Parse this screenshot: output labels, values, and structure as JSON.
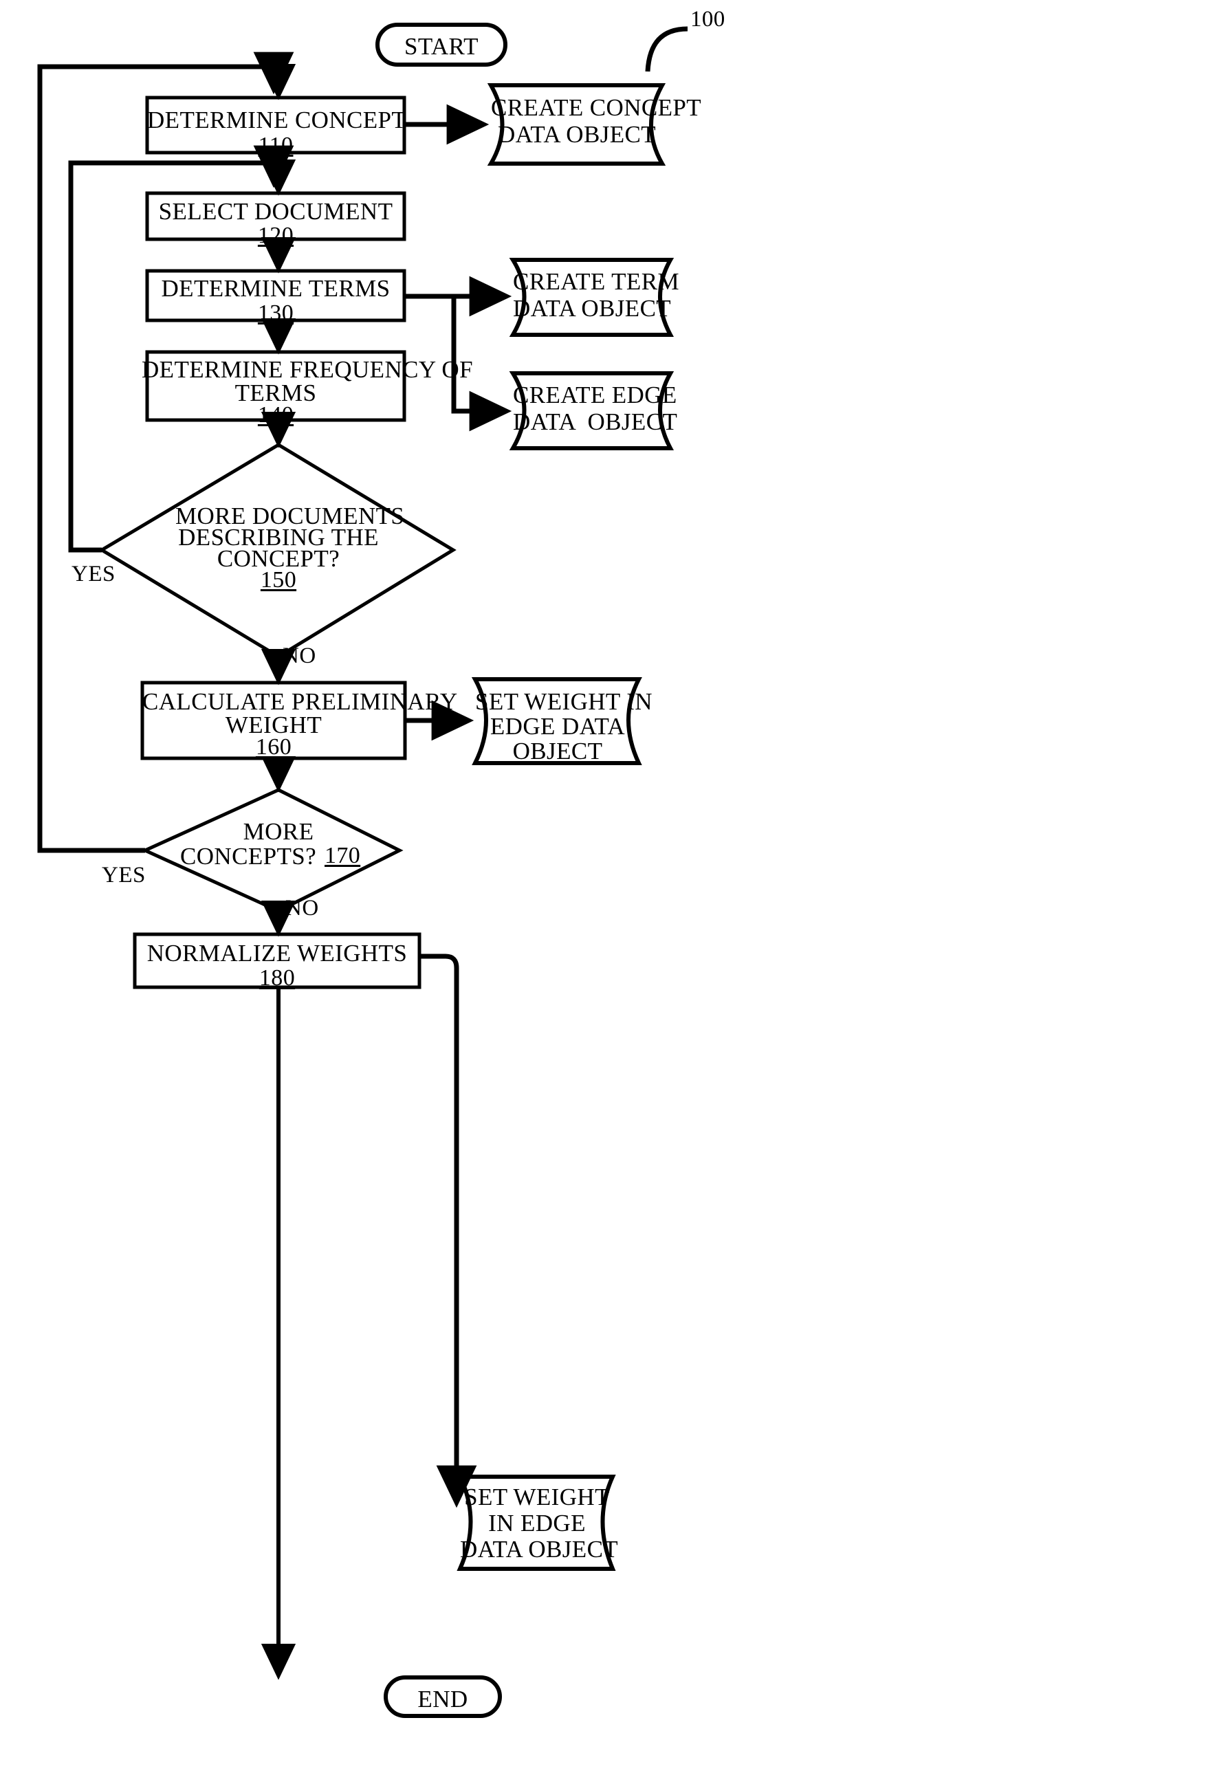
{
  "figure": {
    "reference_numeral": "100"
  },
  "nodes": {
    "start": {
      "label": "START",
      "type": "terminal"
    },
    "end": {
      "label": "END",
      "type": "terminal"
    },
    "determine_concept": {
      "line1": "DETERMINE CONCEPT",
      "ref": "110",
      "type": "process"
    },
    "select_document": {
      "line1": "SELECT DOCUMENT",
      "ref": "120",
      "type": "process"
    },
    "determine_terms": {
      "line1": "DETERMINE TERMS",
      "ref": "130",
      "type": "process"
    },
    "determine_frequency": {
      "line1": "DETERMINE FREQUENCY OF",
      "line2": "TERMS",
      "ref": "140",
      "type": "process"
    },
    "more_documents": {
      "line1": "MORE DOCUMENTS",
      "line2": "DESCRIBING THE",
      "line3": "CONCEPT?",
      "ref": "150",
      "type": "decision"
    },
    "calculate_weight": {
      "line1": "CALCULATE PRELIMINARY",
      "line2": "WEIGHT",
      "ref": "160",
      "type": "process"
    },
    "more_concepts": {
      "line1": "MORE",
      "line2": "CONCEPTS?",
      "ref": "170",
      "type": "decision"
    },
    "normalize_weights": {
      "line1": "NORMALIZE WEIGHTS",
      "ref": "180",
      "type": "process"
    },
    "create_concept_data_object": {
      "line1": "CREATE CONCEPT",
      "line2": "DATA OBJECT",
      "type": "data"
    },
    "create_term_data_object": {
      "line1": "CREATE TERM",
      "line2": "DATA OBJECT",
      "type": "data"
    },
    "create_edge_data_object": {
      "line1": "CREATE EDGE",
      "line2": "DATA  OBJECT",
      "type": "data"
    },
    "set_weight_edge_1": {
      "line1": "SET WEIGHT IN",
      "line2": "EDGE DATA",
      "line3": "OBJECT",
      "type": "data"
    },
    "set_weight_edge_2": {
      "line1": "SET WEIGHT",
      "line2": "IN EDGE",
      "line3": "DATA OBJECT",
      "type": "data"
    }
  },
  "edge_labels": {
    "yes_documents": "YES",
    "no_documents": "NO",
    "yes_concepts": "YES",
    "no_concepts": "NO"
  },
  "colors": {
    "ink": "#000000",
    "paper": "#ffffff"
  }
}
